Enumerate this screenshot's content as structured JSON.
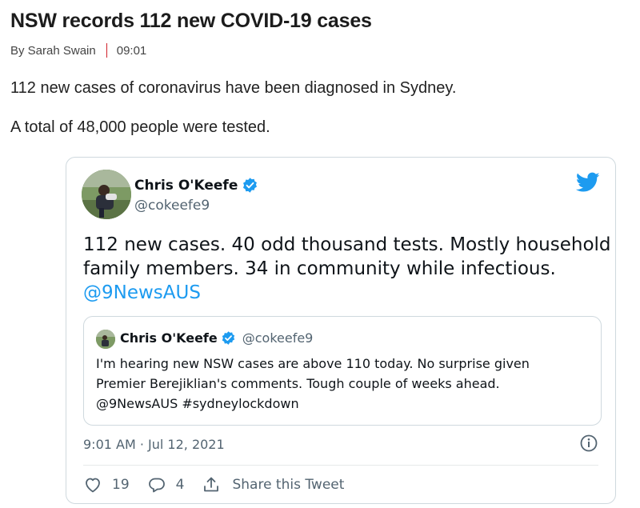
{
  "article": {
    "headline": "NSW records 112 new COVID-19 cases",
    "author": "By Sarah Swain",
    "time": "09:01",
    "paragraphs": [
      "112 new cases of coronavirus have been diagnosed in Sydney.",
      "A total of 48,000 people were tested."
    ]
  },
  "tweet": {
    "author_name": "Chris O'Keefe",
    "author_handle": "@cokeefe9",
    "text_lines": [
      "112 new cases. 40 odd thousand tests. Mostly household",
      "family members. 34 in community while infectious."
    ],
    "mention": "@9NewsAUS",
    "quoted": {
      "author_name": "Chris O'Keefe",
      "author_handle": "@cokeefe9",
      "text_lines": [
        "I'm hearing new NSW cases are above 110 today. No surprise given",
        "Premier Berejiklian's comments. Tough couple of weeks ahead.",
        "@9NewsAUS #sydneylockdown"
      ]
    },
    "timestamp": "9:01 AM · Jul 12, 2021",
    "likes": "19",
    "replies": "4",
    "share_label": "Share this Tweet",
    "icons": {
      "brand": "twitter-bird-icon",
      "verified": "verified-badge-icon",
      "info": "info-icon",
      "like": "heart-icon",
      "reply": "reply-bubble-icon",
      "share": "share-icon"
    }
  },
  "colors": {
    "twitter_blue": "#1d9bf0",
    "byline_separator": "#d0202a",
    "muted_text": "#536471"
  }
}
